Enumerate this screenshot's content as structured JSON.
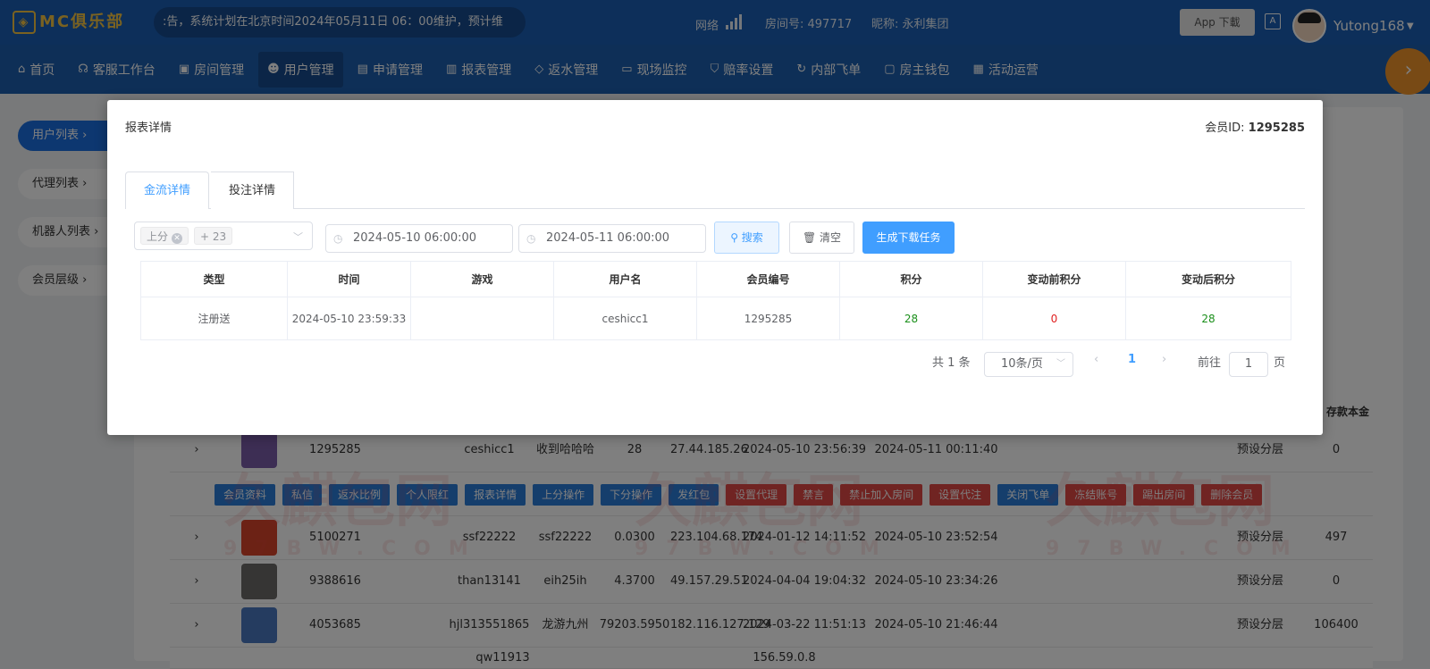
{
  "topbar": {
    "logo": "MC俱乐部",
    "notice": ":告，系统计划在北京时间2024年05月11日 06：00维护，预计维",
    "network_label": "网络",
    "room": "房间号: 497717",
    "nickname": "昵称: 永利集团",
    "app_download": "App 下載",
    "username": "Yutong168"
  },
  "nav": {
    "items": [
      {
        "icon": "home-icon",
        "label": "首页"
      },
      {
        "icon": "headset-icon",
        "label": "客服工作台"
      },
      {
        "icon": "house-icon",
        "label": "房间管理"
      },
      {
        "icon": "user-icon",
        "label": "用户管理",
        "active": true
      },
      {
        "icon": "document-icon",
        "label": "申请管理"
      },
      {
        "icon": "bar-chart-icon",
        "label": "报表管理"
      },
      {
        "icon": "tag-icon",
        "label": "返水管理"
      },
      {
        "icon": "monitor-icon",
        "label": "现场监控"
      },
      {
        "icon": "shield-icon",
        "label": "赔率设置"
      },
      {
        "icon": "rotate-icon",
        "label": "内部飞单"
      },
      {
        "icon": "wallet-icon",
        "label": "房主钱包"
      },
      {
        "icon": "gift-icon",
        "label": "活动运营"
      }
    ]
  },
  "sidebar": {
    "items": [
      {
        "label": "用户列表",
        "active": true
      },
      {
        "label": "代理列表"
      },
      {
        "label": "机器人列表"
      },
      {
        "label": "会员层级"
      }
    ]
  },
  "background": {
    "header_right": "存款本金",
    "rows": [
      {
        "id": "1295285",
        "username": "ceshicc1",
        "nickname": "收到哈哈哈",
        "score": "28",
        "ip": "27.44.185.26",
        "created": "2024-05-10 23:56:39",
        "last": "2024-05-11 00:11:40",
        "layer": "预设分层",
        "deposit": "0"
      },
      {
        "id": "5100271",
        "username": "ssf22222",
        "nickname": "ssf22222",
        "score": "0.0300",
        "ip": "223.104.68.174",
        "created": "2024-01-12 14:11:52",
        "last": "2024-05-10 23:52:54",
        "layer": "预设分层",
        "deposit": "497"
      },
      {
        "id": "9388616",
        "username": "than13141",
        "nickname": "eih25ih",
        "score": "4.3700",
        "ip": "49.157.29.51",
        "created": "2024-04-04 19:04:32",
        "last": "2024-05-10 23:34:26",
        "layer": "预设分层",
        "deposit": "0"
      },
      {
        "id": "4053685",
        "username": "hjl313551865",
        "nickname": "龙游九州",
        "score": "79203.5950",
        "ip": "182.116.127.129",
        "created": "2024-03-22 11:51:13",
        "last": "2024-05-10 21:46:44",
        "layer": "预设分层",
        "deposit": "106400"
      }
    ],
    "actions": [
      {
        "label": "会员资料",
        "color": "b"
      },
      {
        "label": "私信",
        "color": "b"
      },
      {
        "label": "返水比例",
        "color": "b"
      },
      {
        "label": "个人限红",
        "color": "b"
      },
      {
        "label": "报表详情",
        "color": "b"
      },
      {
        "label": "上分操作",
        "color": "b"
      },
      {
        "label": "下分操作",
        "color": "b"
      },
      {
        "label": "发红包",
        "color": "b"
      },
      {
        "label": "设置代理",
        "color": "r"
      },
      {
        "label": "禁言",
        "color": "r"
      },
      {
        "label": "禁止加入房间",
        "color": "r"
      },
      {
        "label": "设置代注",
        "color": "r"
      },
      {
        "label": "关闭飞单",
        "color": "b"
      },
      {
        "label": "冻结账号",
        "color": "r"
      },
      {
        "label": "踢出房间",
        "color": "r"
      },
      {
        "label": "删除会员",
        "color": "r"
      }
    ],
    "partial_row": "qw11913",
    "partial_ip": "156.59.0.8"
  },
  "modal": {
    "title": "报表详情",
    "member_id_label": "会员ID:",
    "member_id": "1295285",
    "tabs": [
      "金流详情",
      "投注详情"
    ],
    "filter_tag": "上分",
    "filter_more": "+ 23",
    "start_date": "2024-05-10 06:00:00",
    "end_date": "2024-05-11 06:00:00",
    "search_btn": "搜索",
    "clear_btn": "清空",
    "generate_btn": "生成下载任务",
    "table": {
      "headers": [
        "类型",
        "时间",
        "游戏",
        "用户名",
        "会员编号",
        "积分",
        "变动前积分",
        "变动后积分"
      ],
      "rows": [
        {
          "type": "注册送",
          "time": "2024-05-10 23:59:33",
          "game": "",
          "username": "ceshicc1",
          "member_no": "1295285",
          "points": "28",
          "before": "0",
          "after": "28"
        }
      ]
    },
    "pagination": {
      "total": "共 1 条",
      "page_size": "10条/页",
      "current": "1",
      "goto_label": "前往",
      "goto_value": "1",
      "page_suffix": "页"
    }
  },
  "watermark": {
    "text": "久麒包网",
    "sub": "97BW.COM"
  },
  "colors": {
    "primary": "#1a5fb4",
    "accent": "#409eff",
    "positive": "#1a8f1a",
    "negative": "#e02020",
    "danger": "#e04845"
  }
}
